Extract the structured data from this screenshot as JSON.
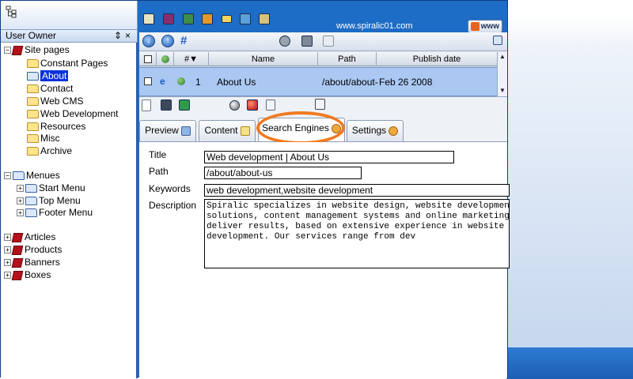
{
  "left_panel": {
    "title": "User Owner",
    "collapse_icon": "⇕",
    "close_icon": "×"
  },
  "tree": {
    "site_pages": "Site pages",
    "pages": [
      "Constant Pages",
      "About",
      "Contact",
      "Web CMS",
      "Web Development",
      "Resources",
      "Misc",
      "Archive"
    ],
    "selected_page": "About",
    "menues": "Menues",
    "menus": [
      "Start Menu",
      "Top Menu",
      "Footer Menu"
    ],
    "groups": [
      "Articles",
      "Products",
      "Banners",
      "Boxes"
    ]
  },
  "header": {
    "site_url": "www.spiralic01.com",
    "www_button": "www",
    "toolbar_icons": [
      "home-icon",
      "books-icon",
      "image-icon",
      "users-icon",
      "mail-icon",
      "chart-icon",
      "person-icon"
    ]
  },
  "list": {
    "columns": [
      "#▼",
      "Name",
      "Path",
      "Publish date"
    ],
    "row": {
      "number": "1",
      "name": "About Us",
      "path": "/about/about-",
      "date": "Feb 26 2008"
    }
  },
  "tabs": {
    "preview": "Preview",
    "content": "Content",
    "search_engines": "Search Engines",
    "settings": "Settings",
    "active": "Search Engines"
  },
  "form": {
    "title_label": "Title",
    "title_value": "Web development | About Us",
    "path_label": "Path",
    "path_value": "/about/about-us",
    "keywords_label": "Keywords",
    "keywords_value": "web development,website development",
    "description_label": "Description",
    "description_value": "Spiralic specializes in website design, website development, e\nsolutions, content management systems and online marketing str\ndeliver results, based on extensive experience in website desi\ndevelopment. Our services range from dev"
  },
  "colors": {
    "frame_blue": "#1d6cc5",
    "selected_row": "#aac8f2",
    "highlight_ring": "#f07a22",
    "tree_selection": "#0b33d8"
  }
}
